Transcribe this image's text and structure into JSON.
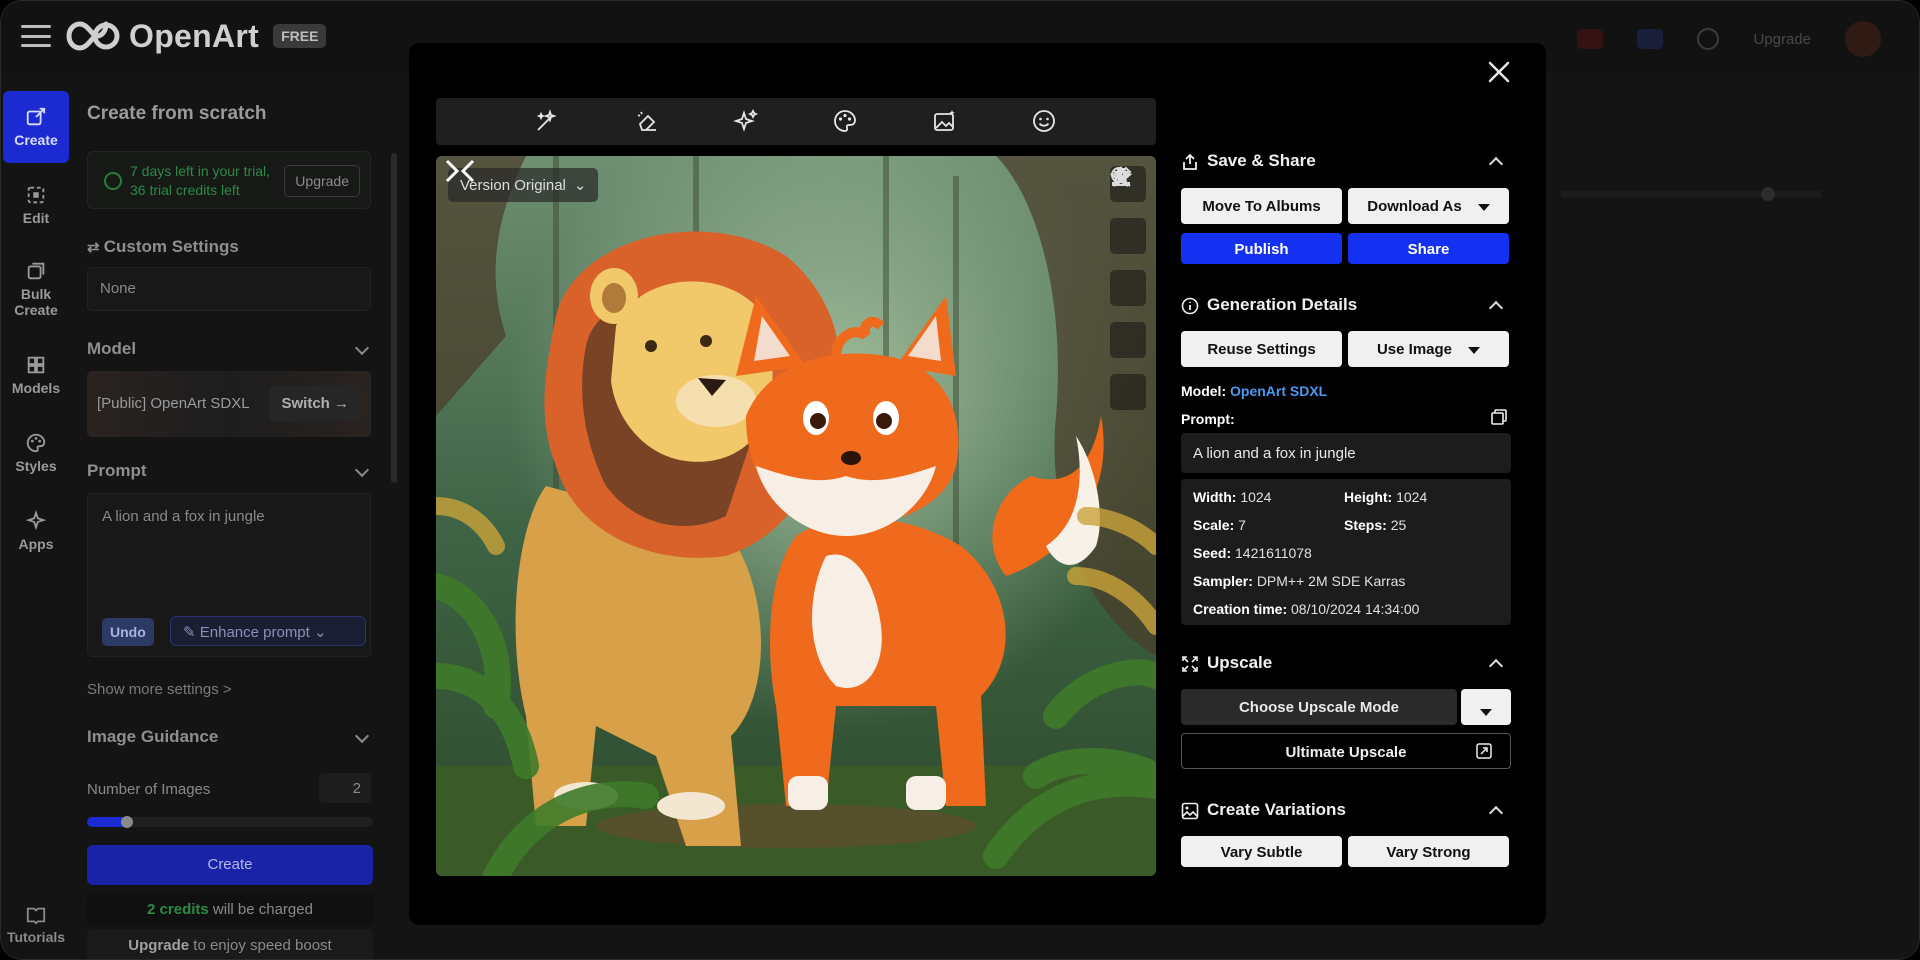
{
  "app": {
    "logo_name": "OpenArt",
    "plan_badge": "FREE",
    "top_right_upgrade": "Upgrade"
  },
  "rail": {
    "items": [
      {
        "label": "Create",
        "icon": "create-icon"
      },
      {
        "label": "Edit",
        "icon": "edit-icon"
      },
      {
        "label": "Bulk Create",
        "icon": "bulk-create-icon"
      },
      {
        "label": "Models",
        "icon": "models-icon"
      },
      {
        "label": "Styles",
        "icon": "palette-icon"
      },
      {
        "label": "Apps",
        "icon": "sparkle-icon"
      }
    ],
    "tutorials": "Tutorials"
  },
  "left_panel": {
    "title": "Create from scratch",
    "trial_line1": "7 days left in your trial,",
    "trial_line2": "36 trial credits left",
    "trial_upgrade": "Upgrade",
    "custom_settings_label": "Custom Settings",
    "custom_settings_value": "None",
    "model_label": "Model",
    "model_name": "[Public] OpenArt SDXL",
    "model_switch": "Switch",
    "prompt_label": "Prompt",
    "prompt_text": "A lion and a fox in jungle",
    "undo": "Undo",
    "enhance": "Enhance prompt",
    "show_more": "Show more settings >",
    "image_guidance": "Image Guidance",
    "num_images_label": "Number of Images",
    "num_images_value": "2",
    "create": "Create",
    "credits_highlight": "2 credits",
    "credits_rest": " will be charged",
    "speed_highlight": "Upgrade",
    "speed_rest": " to enjoy speed boost"
  },
  "viewer": {
    "version_label": "Version Original",
    "toolbar_icons": [
      "magic-wand-icon",
      "eraser-icon",
      "sparkles-icon",
      "palette-icon",
      "image-edit-icon",
      "face-icon"
    ],
    "side_icons": [
      "zoom-in-icon",
      "pencil-icon",
      "download-icon",
      "trash-icon",
      "star-icon"
    ]
  },
  "right_panel": {
    "save_share": {
      "title": "Save & Share",
      "move_to_albums": "Move To Albums",
      "download_as": "Download As",
      "publish": "Publish",
      "share": "Share"
    },
    "generation": {
      "title": "Generation Details",
      "reuse_settings": "Reuse Settings",
      "use_image": "Use Image",
      "model_key": "Model:",
      "model_value": "OpenArt SDXL",
      "prompt_key": "Prompt:",
      "prompt_value": "A lion and a fox in jungle",
      "width_key": "Width:",
      "width_value": "1024",
      "height_key": "Height:",
      "height_value": "1024",
      "scale_key": "Scale:",
      "scale_value": "7",
      "steps_key": "Steps:",
      "steps_value": "25",
      "seed_key": "Seed:",
      "seed_value": "1421611078",
      "sampler_key": "Sampler:",
      "sampler_value": "DPM++ 2M SDE Karras",
      "creation_key": "Creation time:",
      "creation_value": "08/10/2024 14:34:00"
    },
    "upscale": {
      "title": "Upscale",
      "choose_mode": "Choose Upscale Mode",
      "ultimate": "Ultimate Upscale"
    },
    "variations": {
      "title": "Create Variations",
      "vary_subtle": "Vary Subtle",
      "vary_strong": "Vary Strong"
    }
  },
  "colors": {
    "accent_blue": "#1430f0",
    "link_blue": "#4a9af0",
    "trial_green": "#2d8a45"
  }
}
